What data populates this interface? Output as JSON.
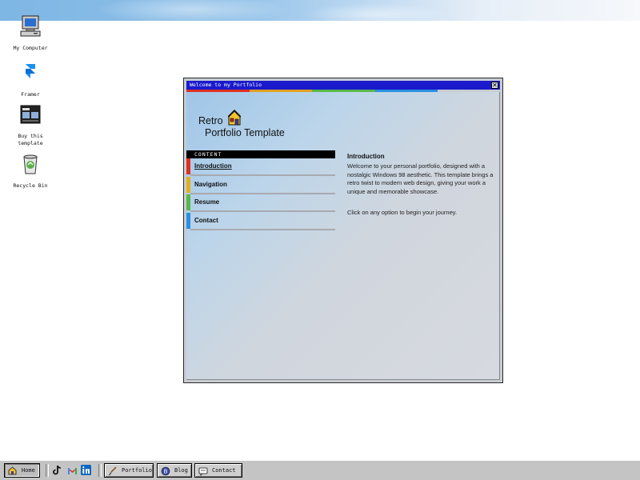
{
  "desktop": {
    "icons": [
      {
        "label": "My Computer",
        "icon": "computer-icon"
      },
      {
        "label": "Framer",
        "icon": "framer-icon"
      },
      {
        "label": "Buy this template",
        "icon": "template-icon"
      },
      {
        "label": "Recycle Bin",
        "icon": "recycle-bin-icon"
      }
    ]
  },
  "window": {
    "title": "Welcome to my Portfolio",
    "close_glyph": "✕",
    "stripe_colors": [
      "#e03020",
      "#e0a020",
      "#58b848",
      "#2a90e0"
    ],
    "logo": {
      "line1": "Retro",
      "line2": "Portfolio Template",
      "icon": "house-icon"
    },
    "menu": {
      "header": "CONTENT",
      "items": [
        {
          "label": "Introduction",
          "color": "#e03020",
          "active": true
        },
        {
          "label": "Navigation",
          "color": "#e0b020",
          "active": false
        },
        {
          "label": "Resume",
          "color": "#58b848",
          "active": false
        },
        {
          "label": "Contact",
          "color": "#2a90e0",
          "active": false
        }
      ]
    },
    "content": {
      "title": "Introduction",
      "body": "Welcome to your personal portfolio, designed with a nostalgic Windows 98 aesthetic. This template brings a retro twist to modern web design, giving your work a unique and memorable showcase.",
      "cta": "Click on any option to begin your journey."
    }
  },
  "taskbar": {
    "home": "Home",
    "social": [
      "tiktok-icon",
      "gmail-icon",
      "linkedin-icon"
    ],
    "buttons": [
      {
        "label": "Portfolio",
        "icon": "paintbrush-icon"
      },
      {
        "label": "Blog",
        "icon": "blog-icon"
      },
      {
        "label": "Contact",
        "icon": "chat-icon"
      }
    ]
  }
}
